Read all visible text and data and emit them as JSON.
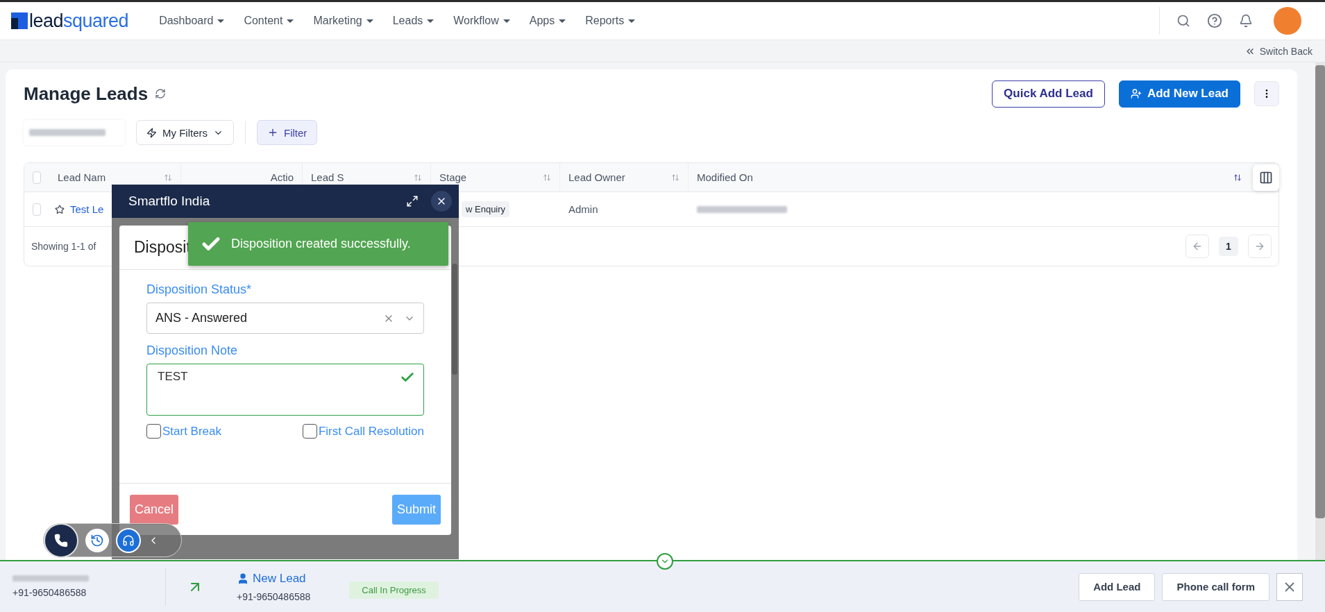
{
  "nav": {
    "logo": {
      "dark": "lead",
      "blue": "squared"
    },
    "items": [
      {
        "label": "Dashboard"
      },
      {
        "label": "Content"
      },
      {
        "label": "Marketing"
      },
      {
        "label": "Leads"
      },
      {
        "label": "Workflow"
      },
      {
        "label": "Apps"
      },
      {
        "label": "Reports"
      }
    ]
  },
  "subbar": {
    "switch_back": "Switch Back"
  },
  "page": {
    "title": "Manage Leads",
    "buttons": [
      {
        "label": "Quick Add Lead",
        "kind": "outline"
      },
      {
        "label": "Add New Lead",
        "kind": "primary"
      }
    ]
  },
  "filters": {
    "my_filters": "My Filters",
    "filter": "Filter"
  },
  "table": {
    "header_checked": false,
    "columns": [
      {
        "label": "Lead Nam",
        "sortable": true
      },
      {
        "label": "Actio",
        "sortable": false
      },
      {
        "label": "Lead S",
        "sortable": true
      },
      {
        "label": "Stage",
        "sortable": true
      },
      {
        "label": "Lead Owner",
        "sortable": true
      },
      {
        "label": "Modified On",
        "sortable": true
      }
    ],
    "rows": [
      {
        "checked": false,
        "starred": false,
        "name": "Test Le",
        "stage": "w Enquiry",
        "owner": "Admin"
      }
    ],
    "footer": "Showing 1-1 of",
    "pages": [
      {
        "label": "1",
        "selected": true
      }
    ]
  },
  "modal": {
    "title": "Smartflo India",
    "dialog_title": "Disposit",
    "toast": "Disposition created successfully.",
    "status_label": "Disposition Status*",
    "status_value": "ANS - Answered",
    "note_label": "Disposition Note",
    "note_value": "TEST",
    "note_valid": true,
    "checkboxes": [
      {
        "label": "Start Break",
        "checked": false
      },
      {
        "label": "First Call Resolution",
        "checked": false
      }
    ],
    "buttons": [
      {
        "label": "Cancel",
        "kind": "danger"
      },
      {
        "label": "Submit",
        "kind": "primary"
      }
    ]
  },
  "call_bar": {
    "caller_number": "+91-9650486588",
    "lead_name": "New Lead",
    "lead_number": "+91-9650486588",
    "status": "Call In Progress",
    "buttons": [
      {
        "label": "Add Lead"
      },
      {
        "label": "Phone call form"
      }
    ]
  }
}
